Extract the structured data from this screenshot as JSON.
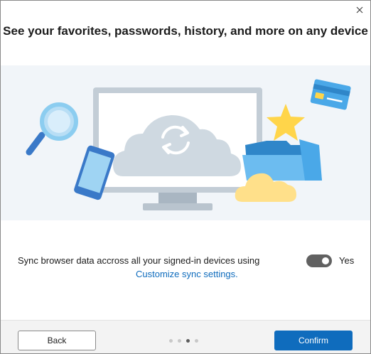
{
  "dialog": {
    "title": "See your favorites, passwords, history, and more on any device",
    "close_icon": "close-icon"
  },
  "hero": {
    "illustration": "sync-illustration",
    "icons": [
      "monitor-icon",
      "cloud-sync-icon",
      "magnifier-icon",
      "phone-icon",
      "credit-card-icon",
      "star-icon",
      "folder-icon",
      "cloud-icon"
    ],
    "colors": {
      "background": "#f1f5f9",
      "monitor": "#c6d0d9",
      "cloud": "#cfd9e1",
      "accent_blue": "#4aa8e8",
      "star": "#ffd54a"
    }
  },
  "sync": {
    "description": "Sync browser data accross all your signed-in devices using",
    "link": "Customize sync settings.",
    "toggle_on": true,
    "toggle_label": "Yes"
  },
  "footer": {
    "back_label": "Back",
    "confirm_label": "Confirm",
    "pager": {
      "total": 4,
      "current": 3
    }
  },
  "colors": {
    "accent": "#0f6cbd",
    "toggle_on": "#616161",
    "footer_bg": "#f3f3f3"
  }
}
